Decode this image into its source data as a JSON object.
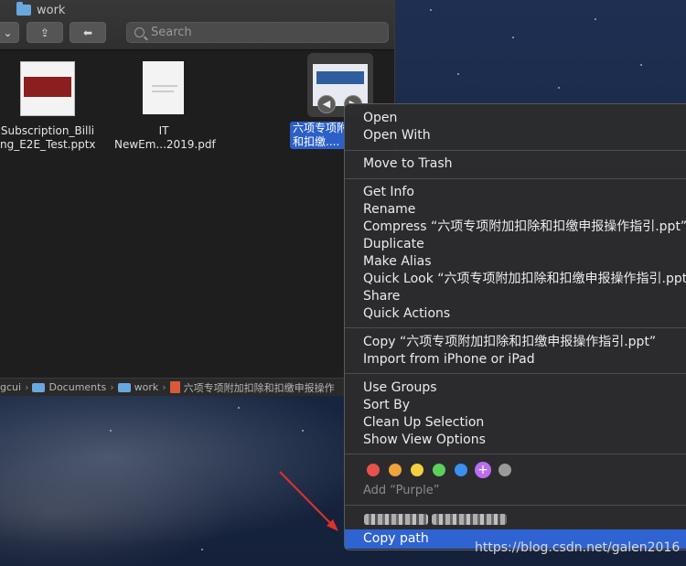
{
  "finder": {
    "title": "work",
    "search_placeholder": "Search",
    "files": [
      {
        "label": "Subscription_Billi\nng_E2E_Test.pptx"
      },
      {
        "label": "IT\nNewEm...2019.pdf"
      },
      {
        "label": "六项专项附\n和扣缴...."
      }
    ],
    "pathbar": {
      "user": "gcui",
      "documents": "Documents",
      "work": "work",
      "file": "六项专项附加扣除和扣缴申报操作"
    }
  },
  "context_menu": {
    "open": "Open",
    "open_with": "Open With",
    "move_to_trash": "Move to Trash",
    "get_info": "Get Info",
    "rename": "Rename",
    "compress": "Compress “六项专项附加扣除和扣缴申报操作指引.ppt”",
    "duplicate": "Duplicate",
    "make_alias": "Make Alias",
    "quick_look": "Quick Look “六项专项附加扣除和扣缴申报操作指引.ppt”",
    "share": "Share",
    "quick_actions": "Quick Actions",
    "copy": "Copy “六项专项附加扣除和扣缴申报操作指引.ppt”",
    "import_iphone": "Import from iPhone or iPad",
    "use_groups": "Use Groups",
    "sort_by": "Sort By",
    "clean_up": "Clean Up Selection",
    "show_view_options": "Show View Options",
    "tag_colors": [
      "#e5534b",
      "#f0a23b",
      "#f3d03f",
      "#5ccf5a",
      "#3b8ff0",
      "#b96ef0",
      "#9a9a9a"
    ],
    "add_tag": "Add “Purple”",
    "copy_path": "Copy path"
  },
  "watermark": "https://blog.csdn.net/galen2016"
}
